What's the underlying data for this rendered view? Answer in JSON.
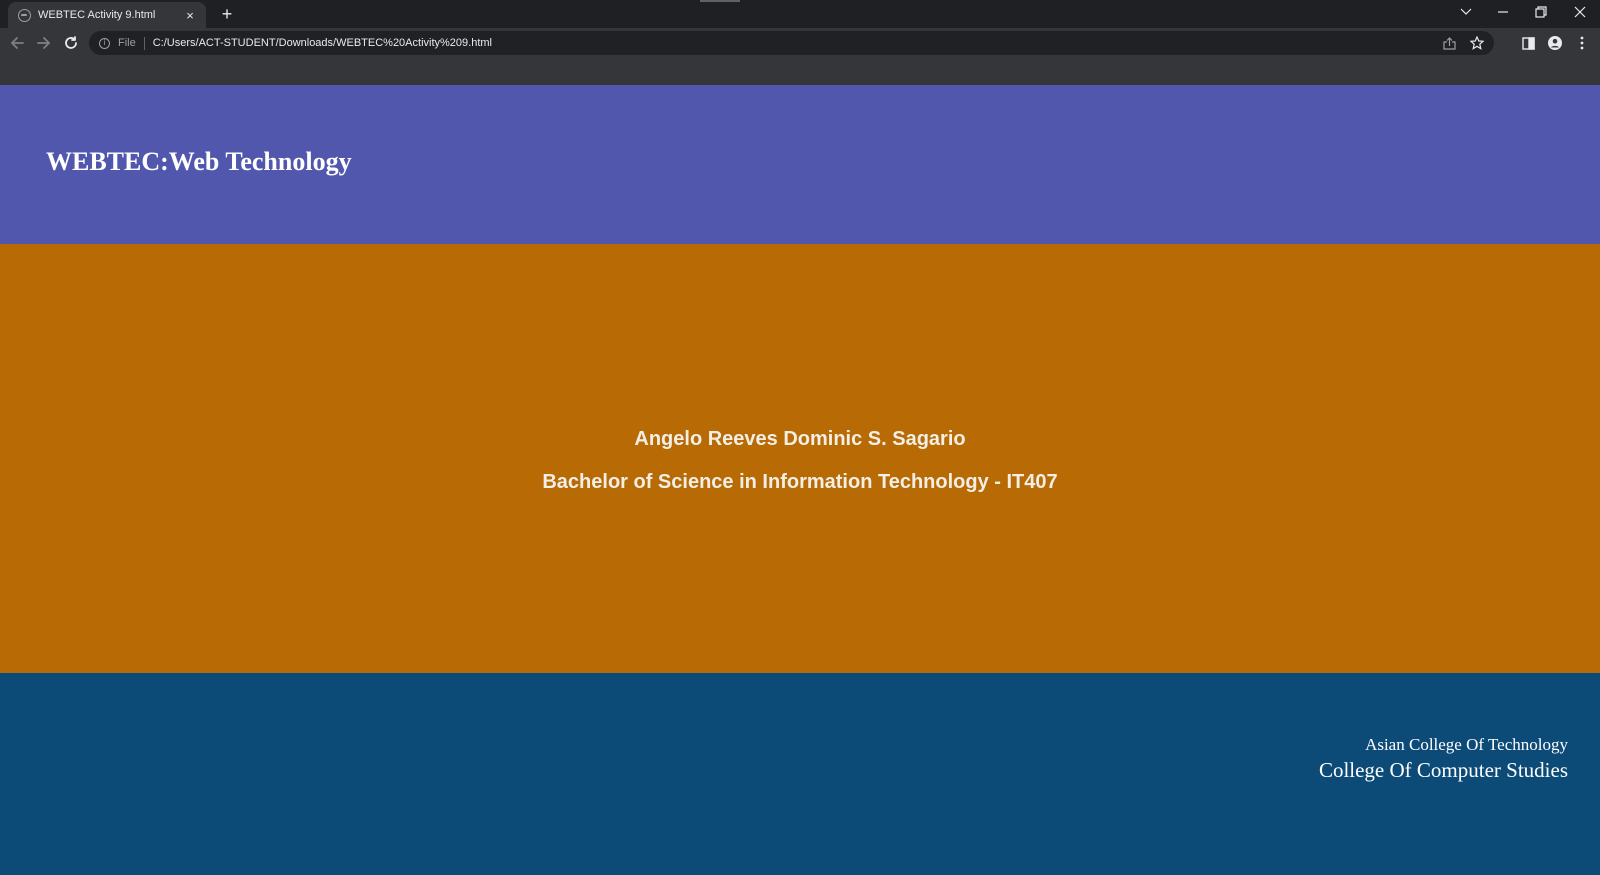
{
  "browser": {
    "tab": {
      "title": "WEBTEC Activity 9.html",
      "favicon": "globe-icon",
      "close_icon": "×"
    },
    "new_tab_icon": "+",
    "address_bar": {
      "scheme_label": "File",
      "url": "C:/Users/ACT-STUDENT/Downloads/WEBTEC%20Activity%209.html"
    }
  },
  "page": {
    "header": {
      "title": "WEBTEC:Web Technology",
      "background": "#5257ae"
    },
    "main": {
      "name": "Angelo Reeves Dominic S. Sagario",
      "program": "Bachelor of Science in Information Technology - IT407",
      "background": "#b86a04"
    },
    "footer": {
      "line1": "Asian College Of Technology",
      "line2": "College Of Computer Studies",
      "background": "#0c4a77"
    }
  }
}
